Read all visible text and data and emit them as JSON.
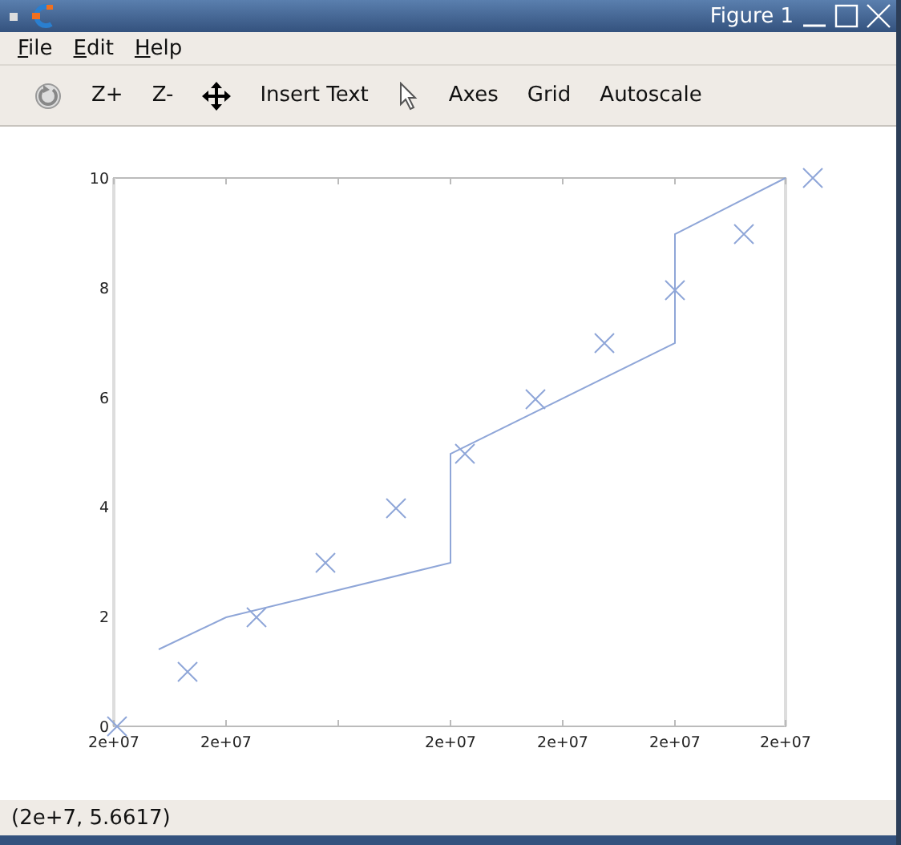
{
  "window": {
    "title": "Figure 1"
  },
  "menu": [
    {
      "label": "File"
    },
    {
      "label": "Edit"
    },
    {
      "label": "Help"
    }
  ],
  "toolbar": [
    {
      "kind": "rotate"
    },
    {
      "kind": "text",
      "label": "Z+"
    },
    {
      "kind": "text",
      "label": "Z-"
    },
    {
      "kind": "pan"
    },
    {
      "kind": "text",
      "label": "Insert Text"
    },
    {
      "kind": "pointer"
    },
    {
      "kind": "text",
      "label": "Axes"
    },
    {
      "kind": "text",
      "label": "Grid"
    },
    {
      "kind": "text",
      "label": "Autoscale"
    }
  ],
  "plot": {
    "y_tick_labels": [
      "10",
      "8",
      "6",
      "4",
      "2",
      "0"
    ],
    "x_tick_labels": [
      "2e+07",
      "2e+07",
      "2e+07",
      "2e+07",
      "2e+07",
      "2e+07"
    ]
  },
  "status_bar": "(2e+7, 5.6617)"
}
